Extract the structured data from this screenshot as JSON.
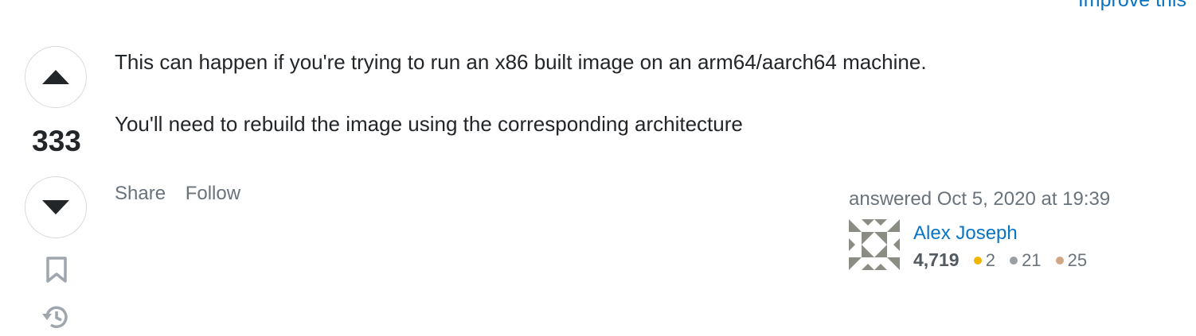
{
  "top_link": "Improve this",
  "vote": {
    "count": "333",
    "upvote_icon": "triangle-up-icon",
    "downvote_icon": "triangle-down-icon",
    "bookmark_icon": "bookmark-icon",
    "history_icon": "history-icon"
  },
  "answer": {
    "paragraphs": [
      "This can happen if you're trying to run an x86 built image on an arm64/aarch64 machine.",
      "You'll need to rebuild the image using the corresponding architecture"
    ]
  },
  "post_menu": {
    "share": "Share",
    "follow": "Follow"
  },
  "user": {
    "action_time": "answered Oct 5, 2020 at 19:39",
    "name": "Alex Joseph",
    "reputation": "4,719",
    "badges": {
      "gold": "2",
      "silver": "21",
      "bronze": "25"
    },
    "avatar_icon": "identicon-avatar"
  },
  "colors": {
    "link": "#0a74c4",
    "muted": "#6a737c",
    "gold": "#f1b600",
    "silver": "#9a9ea3",
    "bronze": "#d1a684",
    "avatar": "#8a8d84"
  }
}
